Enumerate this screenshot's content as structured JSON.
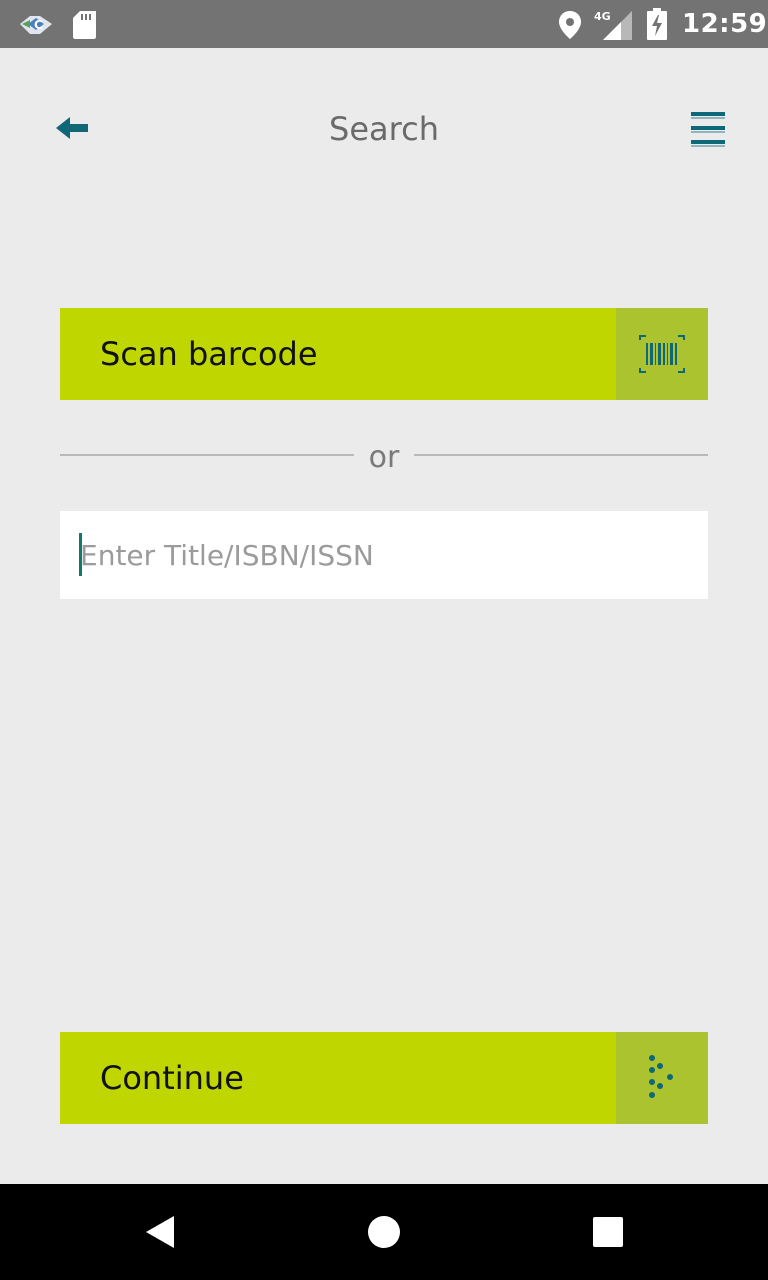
{
  "status_bar": {
    "time": "12:59",
    "network_label": "4G",
    "icons": [
      "app-notification-icon",
      "sd-card-icon",
      "location-icon",
      "signal-icon",
      "battery-charging-icon"
    ]
  },
  "header": {
    "title": "Search",
    "back_icon": "back-arrow-icon",
    "menu_icon": "hamburger-menu-icon"
  },
  "scan": {
    "label": "Scan barcode",
    "icon": "barcode-scan-icon"
  },
  "divider": {
    "text": "or"
  },
  "search": {
    "placeholder": "Enter Title/ISBN/ISSN",
    "value": ""
  },
  "continue": {
    "label": "Continue",
    "icon": "dots-arrow-icon"
  },
  "nav_bar": {
    "icons": [
      "nav-back-icon",
      "nav-home-icon",
      "nav-recents-icon"
    ]
  },
  "colors": {
    "accent_green": "#bfd600",
    "accent_green_dark": "#abc32e",
    "teal": "#0e6878",
    "background": "#ebebeb"
  }
}
